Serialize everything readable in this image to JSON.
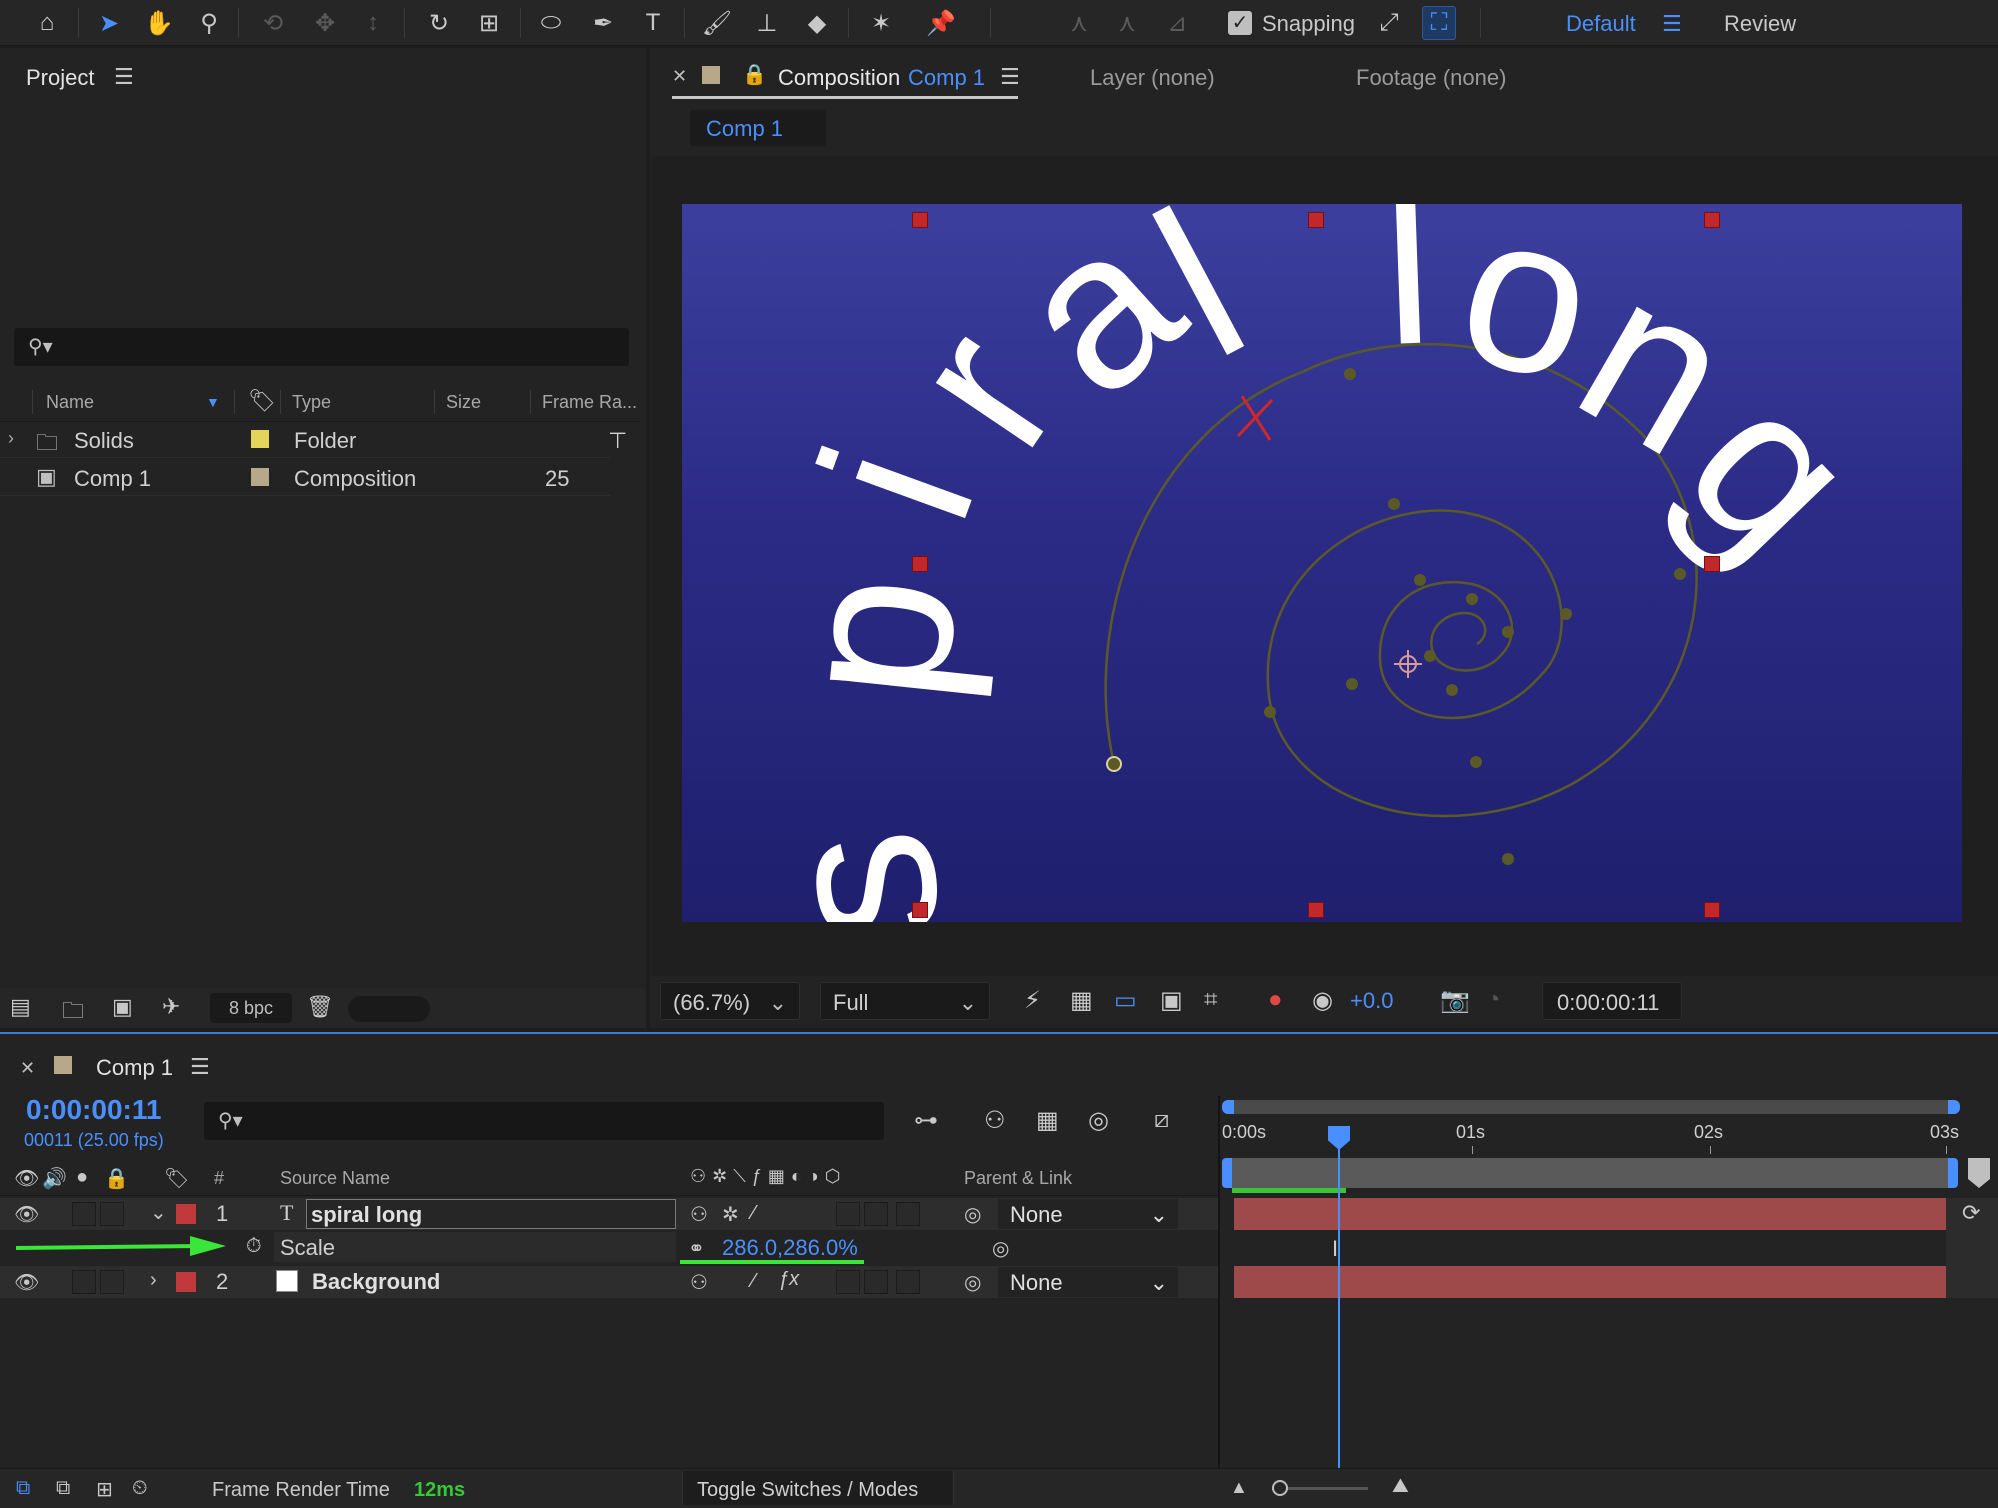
{
  "toolbar": {
    "snapping_label": "Snapping",
    "workspace_active": "Default",
    "workspace_other": "Review",
    "icons": [
      "home-icon",
      "selection-tool-icon",
      "hand-tool-icon",
      "zoom-tool-icon",
      "orbit-camera-icon",
      "pan-camera-icon",
      "dolly-camera-icon",
      "rotation-tool-icon",
      "pan-behind-icon",
      "ellipse-tool-icon",
      "pen-tool-icon",
      "type-tool-icon",
      "brush-tool-icon",
      "clone-stamp-icon",
      "eraser-tool-icon",
      "roto-brush-icon",
      "puppet-pin-icon"
    ]
  },
  "project": {
    "title": "Project",
    "columns": [
      "Name",
      "Type",
      "Size",
      "Frame Ra..."
    ],
    "items": [
      {
        "name": "Solids",
        "type": "Folder",
        "size": "",
        "frame_rate": "",
        "label_color": "#e3d45c"
      },
      {
        "name": "Comp 1",
        "type": "Composition",
        "size": "",
        "frame_rate": "25",
        "label_color": "#b6a888"
      }
    ],
    "bit_depth": "8 bpc"
  },
  "composition": {
    "tab_prefix": "Composition",
    "tab_name": "Comp 1",
    "layer_tab": "Layer (none)",
    "footage_tab": "Footage (none)",
    "subtab": "Comp 1",
    "canvas_text": [
      "s",
      "p",
      "i",
      "r",
      "a",
      "l",
      "l",
      "o",
      "n",
      "g"
    ],
    "zoom": "(66.7%)",
    "resolution": "Full",
    "exposure": "+0.0",
    "timecode": "0:00:00:11"
  },
  "timeline": {
    "tab_name": "Comp 1",
    "current_time": "0:00:00:11",
    "frames_fps": "00011 (25.00 fps)",
    "col_hash": "#",
    "col_source": "Source Name",
    "col_parent": "Parent & Link",
    "ruler": [
      "0:00s",
      "01s",
      "02s",
      "03s"
    ],
    "layers": [
      {
        "num": "1",
        "name": "spiral long",
        "parent": "None",
        "color": "#c0393b",
        "type_glyph": "T"
      },
      {
        "num": "2",
        "name": "Background",
        "parent": "None",
        "color": "#c0393b"
      }
    ],
    "property": {
      "name": "Scale",
      "value": "286.0,286.0%"
    },
    "frame_render_label": "Frame Render Time",
    "frame_render_value": "12ms",
    "toggle_label": "Toggle Switches / Modes"
  },
  "colors": {
    "accent": "#4a8fff",
    "layer_bar": "#9e4a4a",
    "annotation_arrow": "#39e639"
  }
}
